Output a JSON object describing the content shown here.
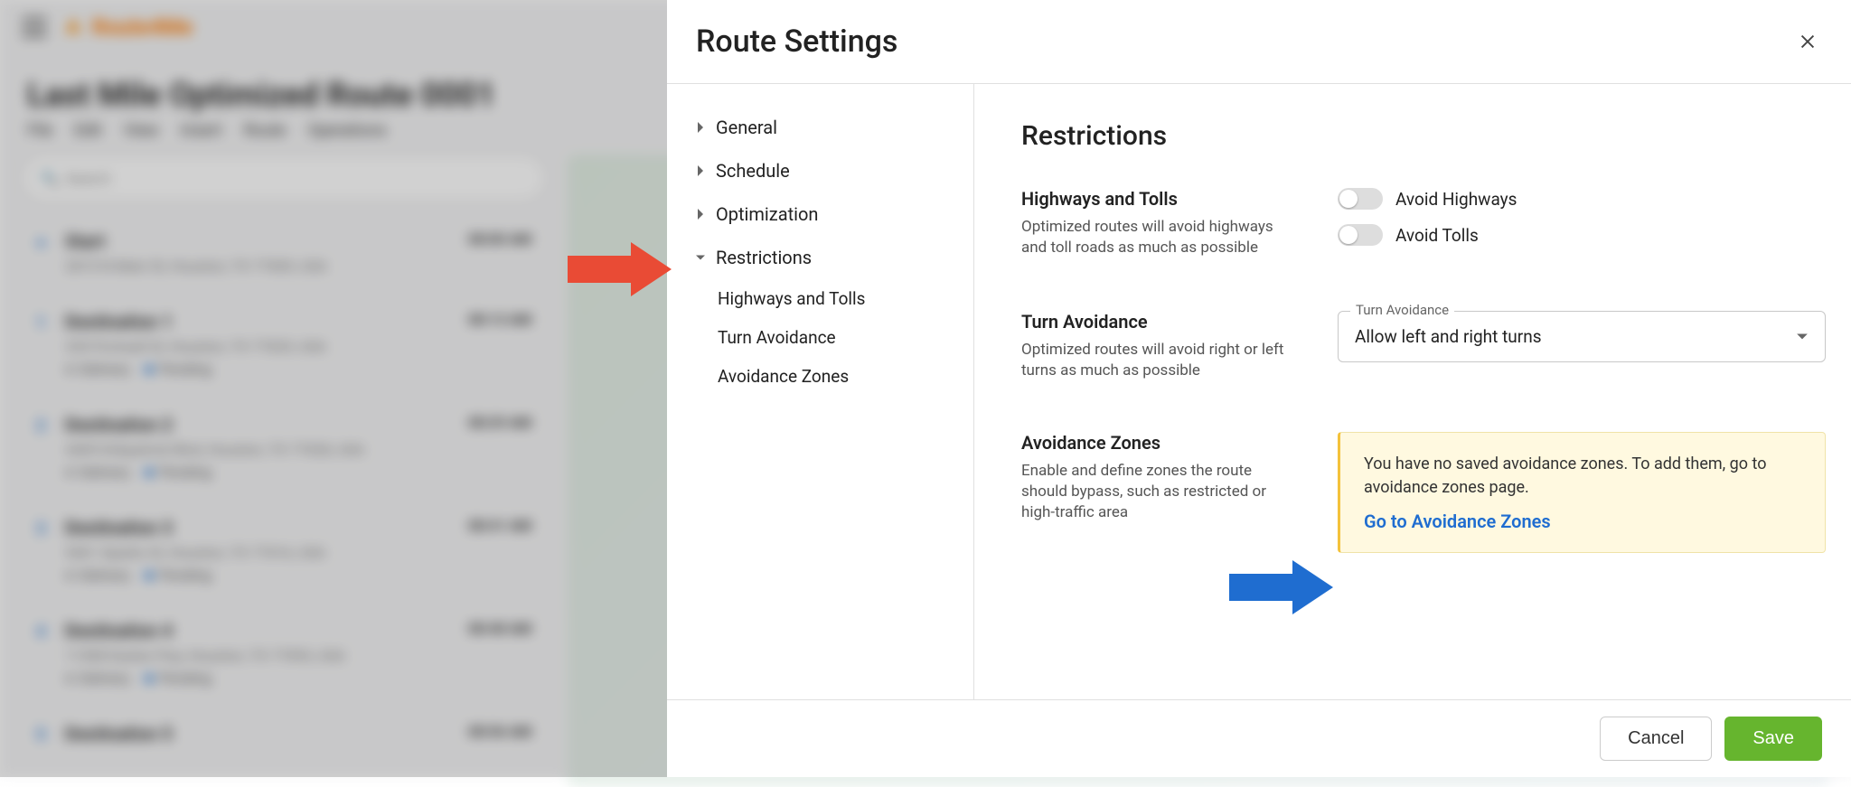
{
  "app": {
    "brand": "Route4Me",
    "route_title": "Last Mile Optimized Route 0001",
    "menu": [
      "File",
      "Edit",
      "View",
      "Insert",
      "Route",
      "Operations"
    ],
    "search_placeholder": "Search"
  },
  "stops": [
    {
      "idx": "",
      "name": "Start",
      "time": "08:00 AM",
      "addr": "2815 N Main St, Houston, TX 77009, USA",
      "delivery": "",
      "status": ""
    },
    {
      "idx": "1",
      "name": "Destination 1",
      "time": "08:13 AM",
      "addr": "335 Portwall St, Houston, TX 77029, USA",
      "delivery": "Delivery",
      "status": "Pending"
    },
    {
      "idx": "2",
      "name": "Destination 2",
      "time": "08:29 AM",
      "addr": "4409 Kirkpatrick Blvd, Houston, TX 77028, USA",
      "delivery": "Delivery",
      "status": "Pending"
    },
    {
      "idx": "3",
      "name": "Destination 3",
      "time": "08:41 AM",
      "addr": "5461 Sparks St, Houston, TX 77016, USA",
      "delivery": "Delivery",
      "status": "Pending"
    },
    {
      "idx": "4",
      "name": "Destination 4",
      "time": "08:48 AM",
      "addr": "11508 Eastex Pwy, Houston, TX 77093, USA",
      "delivery": "Delivery",
      "status": "Pending"
    },
    {
      "idx": "5",
      "name": "Destination 5",
      "time": "08:56 AM",
      "addr": "",
      "delivery": "",
      "status": ""
    }
  ],
  "modal": {
    "title": "Route Settings",
    "nav": {
      "general": "General",
      "schedule": "Schedule",
      "optimization": "Optimization",
      "restrictions": "Restrictions",
      "sub_highways": "Highways and Tolls",
      "sub_turn": "Turn Avoidance",
      "sub_zones": "Avoidance Zones"
    },
    "content": {
      "section_title": "Restrictions",
      "highways": {
        "title": "Highways and Tolls",
        "desc": "Optimized routes will avoid highways and toll roads as much as possible",
        "toggle1": "Avoid Highways",
        "toggle2": "Avoid Tolls"
      },
      "turn": {
        "title": "Turn Avoidance",
        "desc": "Optimized routes will avoid right or left turns as much as possible",
        "select_label": "Turn Avoidance",
        "select_value": "Allow left and right turns"
      },
      "zones": {
        "title": "Avoidance Zones",
        "desc": "Enable and define zones the route should bypass, such as restricted or high-traffic area",
        "notice": "You have no saved avoidance zones. To add them, go to avoidance zones page.",
        "link": "Go to Avoidance Zones"
      }
    },
    "footer": {
      "cancel": "Cancel",
      "save": "Save"
    }
  }
}
